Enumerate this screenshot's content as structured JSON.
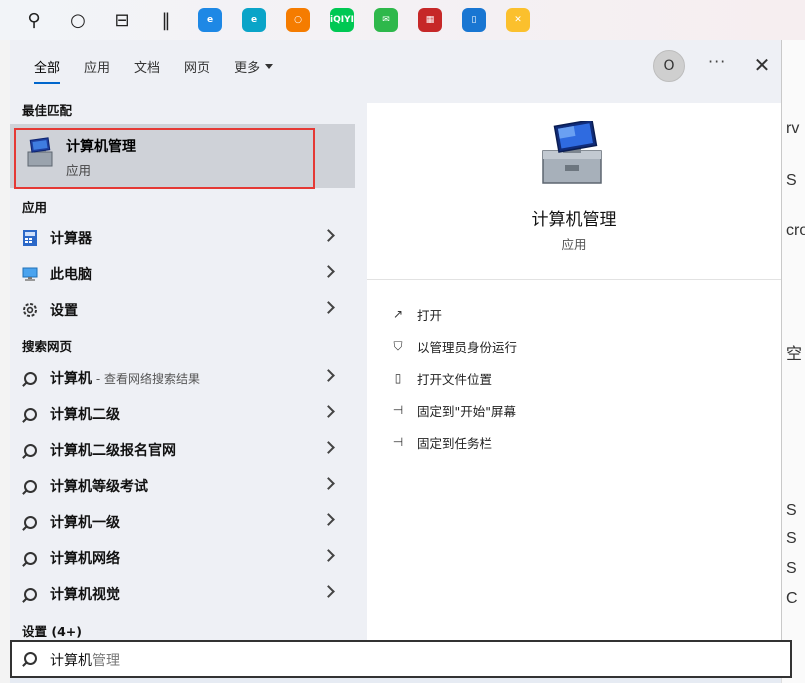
{
  "taskbar": {
    "items": [
      {
        "name": "search-icon",
        "glyph": "⚲"
      },
      {
        "name": "cortana-icon",
        "glyph": "○"
      },
      {
        "name": "task-view-icon",
        "glyph": "⊟"
      },
      {
        "name": "divider-icon",
        "glyph": "‖"
      }
    ],
    "apps": [
      {
        "name": "ie-app-icon",
        "color": "#1e88e5",
        "text": "e"
      },
      {
        "name": "edge-app-icon",
        "color": "#0aa4c8",
        "text": "e"
      },
      {
        "name": "360-browser-app-icon",
        "color": "#f57c00",
        "text": "○"
      },
      {
        "name": "iqiyi-app-icon",
        "color": "#00c853",
        "text": "iQIYI"
      },
      {
        "name": "wechat-app-icon",
        "color": "#2eb84b",
        "text": "✉"
      },
      {
        "name": "toolbox-app-icon",
        "color": "#c62828",
        "text": "▦"
      },
      {
        "name": "phone-app-icon",
        "color": "#1976d2",
        "text": "▯"
      },
      {
        "name": "tools-app-icon",
        "color": "#fbc02d",
        "text": "✕"
      }
    ]
  },
  "tabs": [
    {
      "label": "全部",
      "active": true
    },
    {
      "label": "应用",
      "active": false
    },
    {
      "label": "文档",
      "active": false
    },
    {
      "label": "网页",
      "active": false
    },
    {
      "label": "更多",
      "active": false,
      "dropdown": true
    }
  ],
  "avatar_letter": "O",
  "more_label": "···",
  "close_label": "✕",
  "left": {
    "best_match_header": "最佳匹配",
    "best_match": {
      "title": "计算机管理",
      "subtitle": "应用"
    },
    "apps_header": "应用",
    "apps": [
      {
        "label": "计算器",
        "icon": "calculator-icon"
      },
      {
        "label": "此电脑",
        "icon": "computer-icon"
      },
      {
        "label": "设置",
        "icon": "gear-icon"
      }
    ],
    "web_header": "搜索网页",
    "web": [
      {
        "label": "计算机",
        "hint": " - 查看网络搜索结果"
      },
      {
        "label": "计算机二级",
        "hint": ""
      },
      {
        "label": "计算机二级报名官网",
        "hint": ""
      },
      {
        "label": "计算机等级考试",
        "hint": ""
      },
      {
        "label": "计算机一级",
        "hint": ""
      },
      {
        "label": "计算机网络",
        "hint": ""
      },
      {
        "label": "计算机视觉",
        "hint": ""
      }
    ],
    "settings_header": "设置 (4+)"
  },
  "right": {
    "title": "计算机管理",
    "subtitle": "应用",
    "actions": [
      {
        "label": "打开",
        "icon": "open-icon",
        "glyph": "↗"
      },
      {
        "label": "以管理员身份运行",
        "icon": "admin-shield-icon",
        "glyph": "⛉"
      },
      {
        "label": "打开文件位置",
        "icon": "file-location-icon",
        "glyph": "▯"
      },
      {
        "label": "固定到\"开始\"屏幕",
        "icon": "pin-start-icon",
        "glyph": "⊣"
      },
      {
        "label": "固定到任务栏",
        "icon": "pin-taskbar-icon",
        "glyph": "⊣"
      }
    ]
  },
  "search": {
    "typed": "计算机",
    "completion": "管理"
  },
  "peek_right": [
    "rv",
    "S",
    "cro",
    "空",
    "S",
    "S",
    "S",
    "C"
  ]
}
